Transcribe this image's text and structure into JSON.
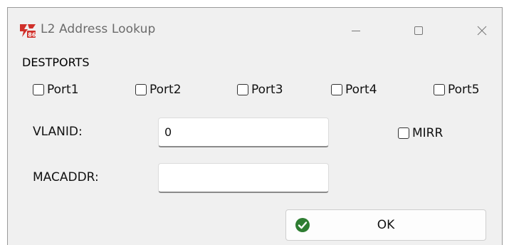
{
  "window": {
    "title": "L2 Address Lookup",
    "app_icon": "app-logo-icon",
    "controls": {
      "minimize_icon": "minimize-icon",
      "maximize_icon": "maximize-icon",
      "close_icon": "close-icon"
    }
  },
  "destports": {
    "group_label": "DESTPORTS",
    "ports": [
      {
        "label": "Port1",
        "checked": false
      },
      {
        "label": "Port2",
        "checked": false
      },
      {
        "label": "Port3",
        "checked": false
      },
      {
        "label": "Port4",
        "checked": false
      },
      {
        "label": "Port5",
        "checked": false
      }
    ]
  },
  "fields": {
    "vlanid": {
      "label": "VLANID:",
      "value": "0"
    },
    "macaddr": {
      "label": "MACADDR:",
      "value": ""
    }
  },
  "mirr": {
    "label": "MIRR",
    "checked": false
  },
  "ok_button": {
    "label": "OK",
    "icon": "check-circle-icon",
    "icon_color": "#2e7d32"
  },
  "colors": {
    "window_bg": "#f0f0f0",
    "title_text": "#6b6b6b",
    "logo_red": "#d0302a"
  }
}
